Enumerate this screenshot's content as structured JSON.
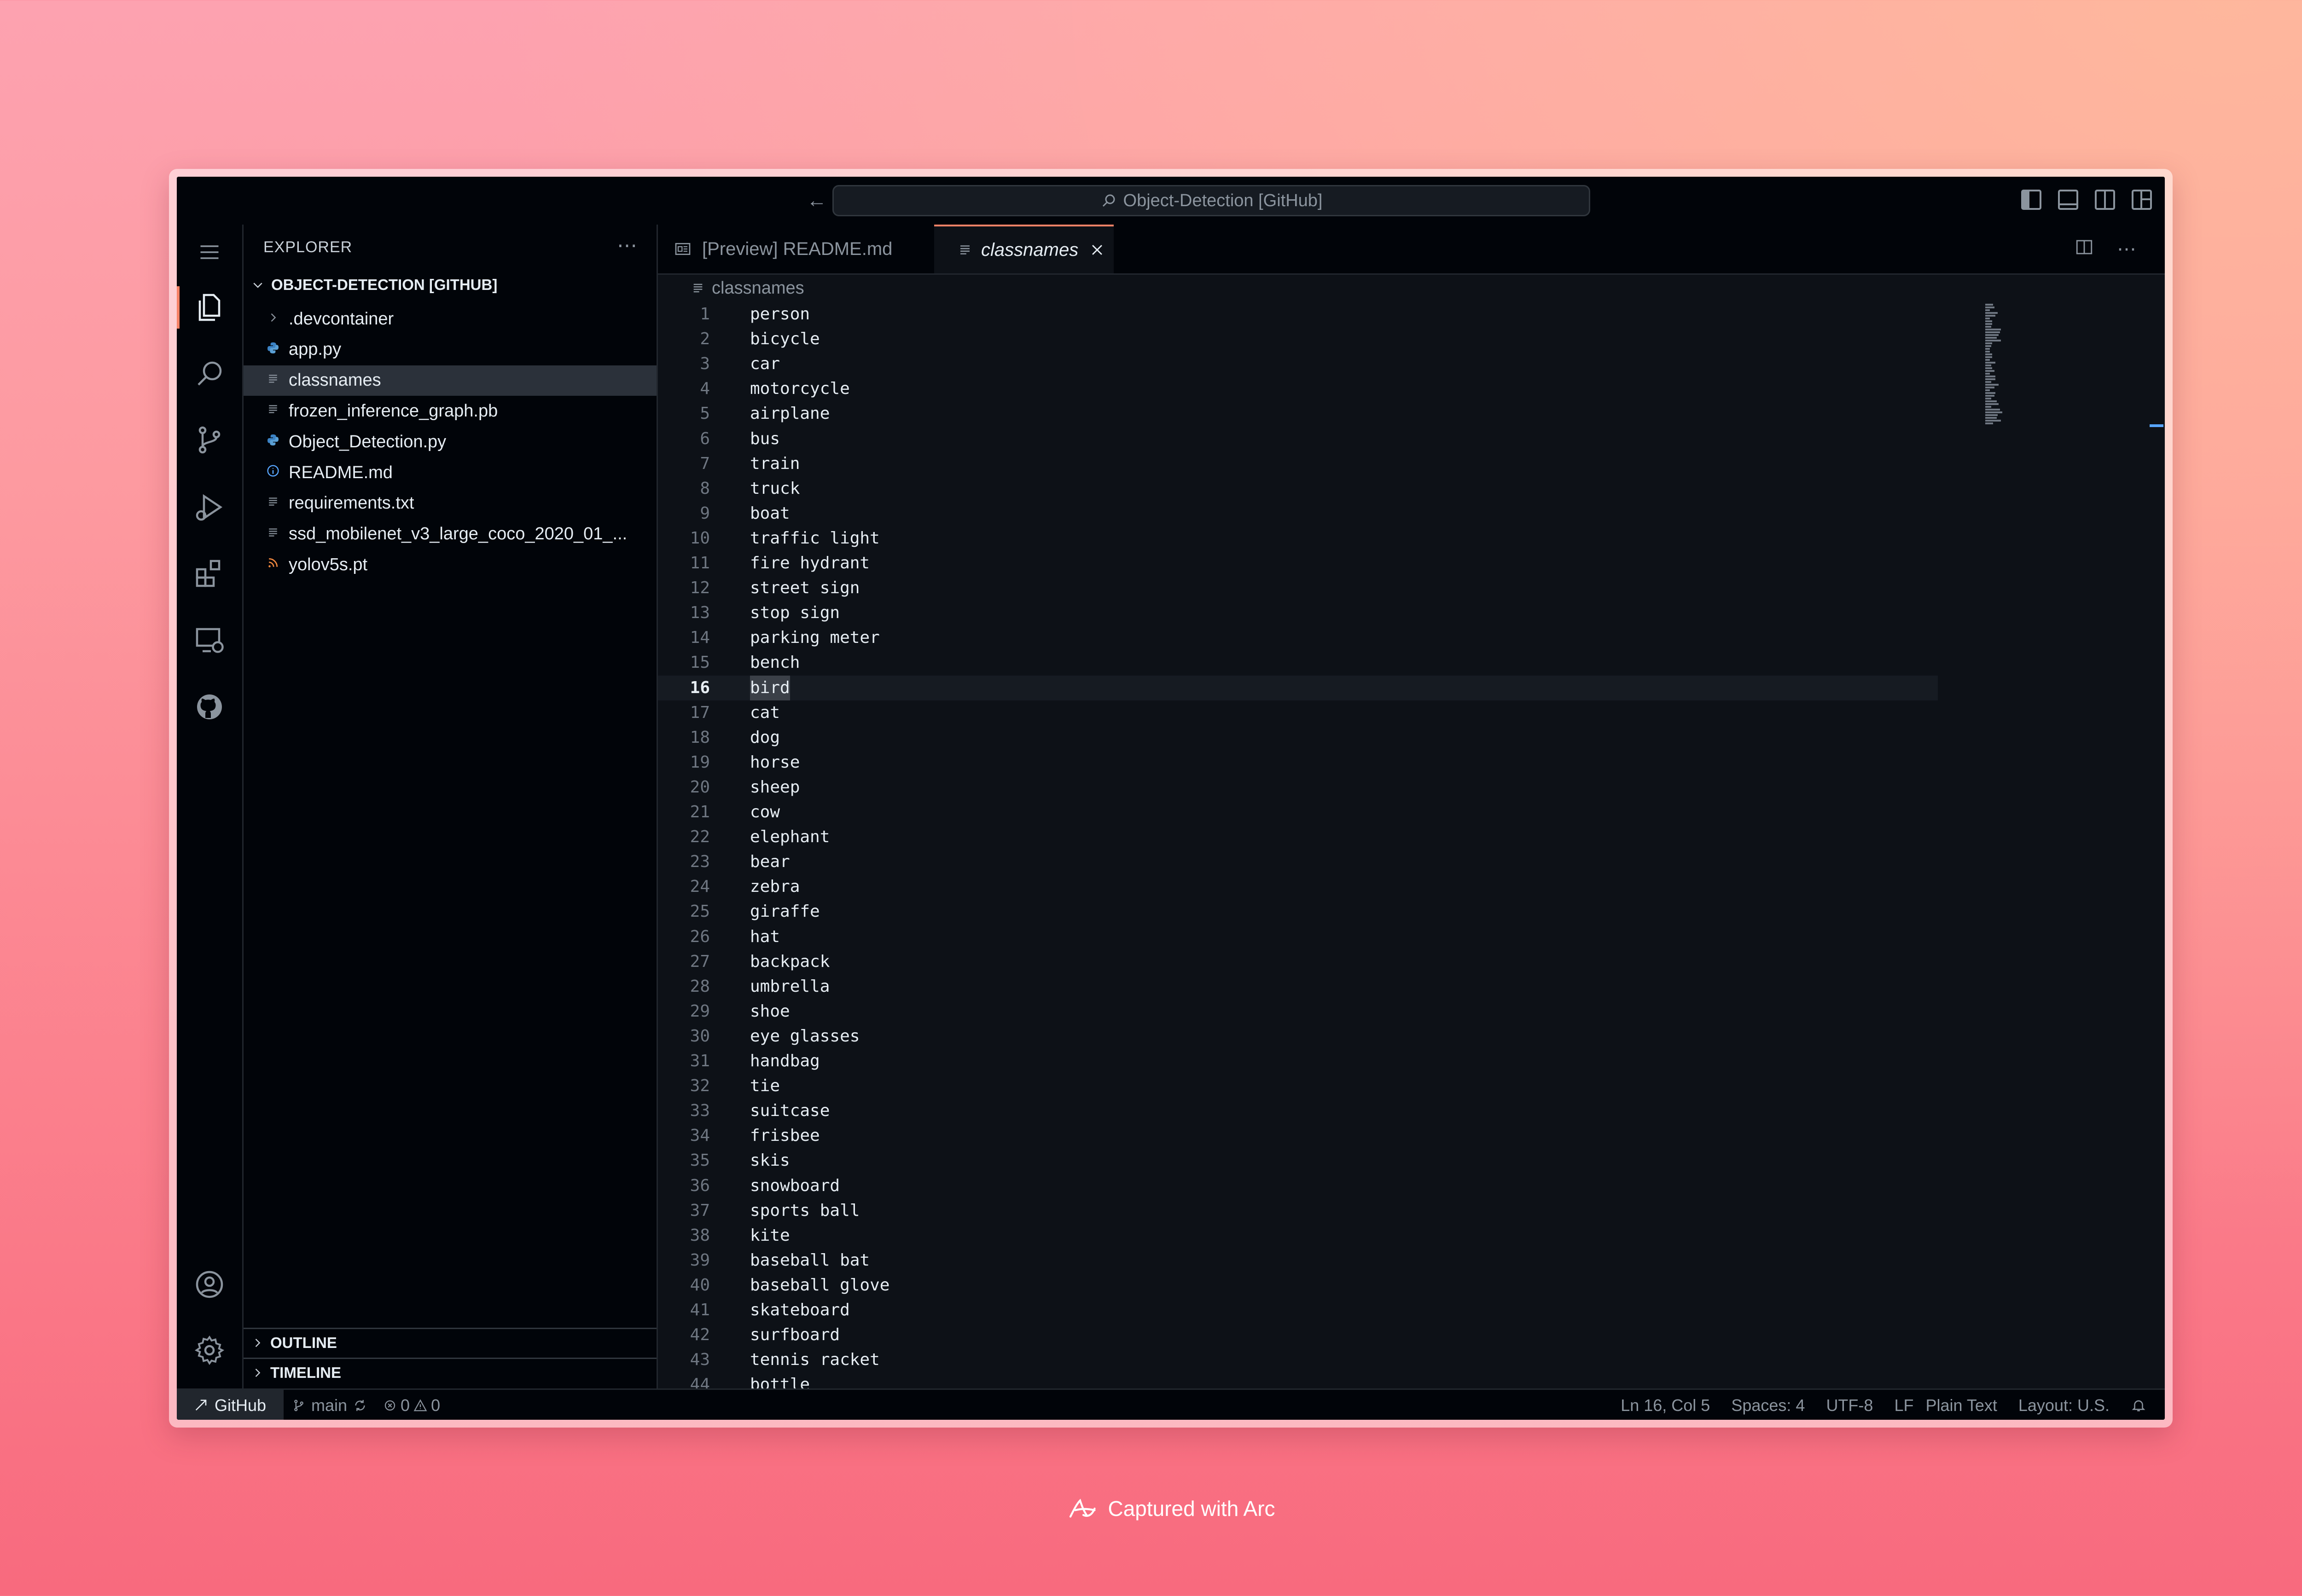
{
  "window": {
    "search_title": "Object-Detection [GitHub]"
  },
  "sidebar": {
    "title": "EXPLORER",
    "root": "OBJECT-DETECTION [GITHUB]",
    "items": [
      {
        "label": ".devcontainer",
        "icon": "chevron-right-icon"
      },
      {
        "label": "app.py",
        "icon": "python-icon"
      },
      {
        "label": "classnames",
        "icon": "text-file-icon",
        "selected": true
      },
      {
        "label": "frozen_inference_graph.pb",
        "icon": "text-file-icon"
      },
      {
        "label": "Object_Detection.py",
        "icon": "python-icon"
      },
      {
        "label": "README.md",
        "icon": "info-icon"
      },
      {
        "label": "requirements.txt",
        "icon": "text-file-icon"
      },
      {
        "label": "ssd_mobilenet_v3_large_coco_2020_01_...",
        "icon": "text-file-icon"
      },
      {
        "label": "yolov5s.pt",
        "icon": "rss-icon"
      }
    ],
    "outline": "OUTLINE",
    "timeline": "TIMELINE"
  },
  "tabs": [
    {
      "label": "[Preview] README.md",
      "icon": "preview-icon"
    },
    {
      "label": "classnames",
      "icon": "text-file-icon",
      "active": true
    }
  ],
  "breadcrumb": "classnames",
  "editor": {
    "current_line": 16,
    "lines": [
      "person",
      "bicycle",
      "car",
      "motorcycle",
      "airplane",
      "bus",
      "train",
      "truck",
      "boat",
      "traffic light",
      "fire hydrant",
      "street sign",
      "stop sign",
      "parking meter",
      "bench",
      "bird",
      "cat",
      "dog",
      "horse",
      "sheep",
      "cow",
      "elephant",
      "bear",
      "zebra",
      "giraffe",
      "hat",
      "backpack",
      "umbrella",
      "shoe",
      "eye glasses",
      "handbag",
      "tie",
      "suitcase",
      "frisbee",
      "skis",
      "snowboard",
      "sports ball",
      "kite",
      "baseball bat",
      "baseball glove",
      "skateboard",
      "surfboard",
      "tennis racket",
      "bottle"
    ]
  },
  "statusbar": {
    "remote": "GitHub",
    "branch": "main",
    "errors": "0",
    "warnings": "0",
    "position": "Ln 16, Col 5",
    "spaces": "Spaces: 4",
    "encoding": "UTF-8",
    "eol": "LF",
    "language": "Plain Text",
    "layout": "Layout: U.S."
  },
  "caption": "Captured with Arc",
  "colors": {
    "accent": "#f78166",
    "background": "#0d1117",
    "sidebar": "#010409"
  }
}
